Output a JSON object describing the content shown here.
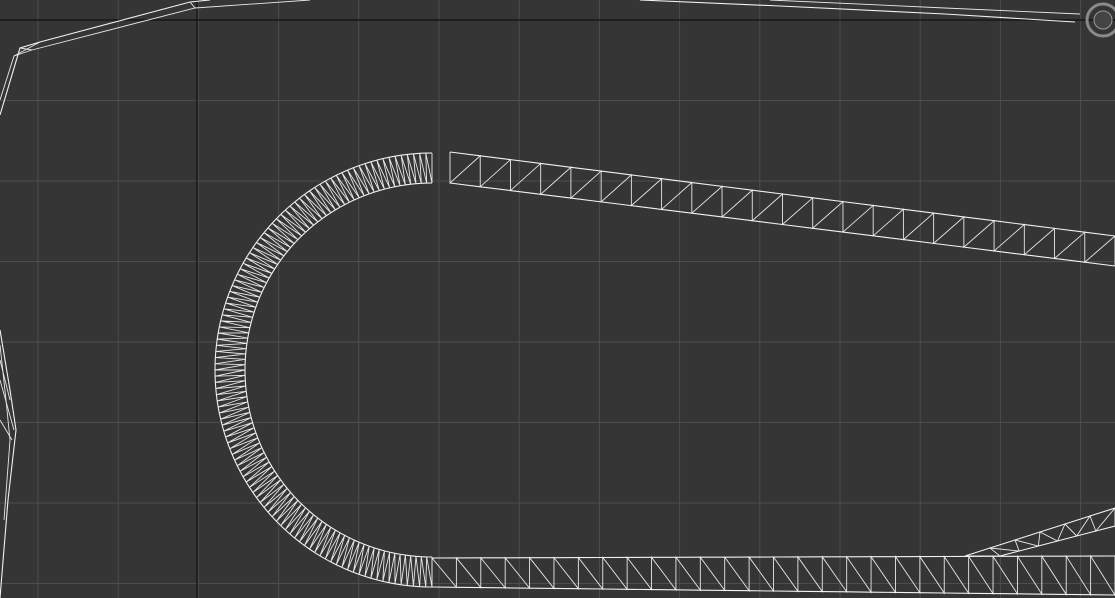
{
  "viewport": {
    "background_color": "#353535",
    "grid_color": "#4d4d4d",
    "world_axis_color": "#111111",
    "wireframe_color": "#e8e8e8"
  },
  "scene": {
    "objects": [
      {
        "name": "track-mesh",
        "kind": "wireframe-road-loop"
      },
      {
        "name": "left-edge-mesh",
        "kind": "wireframe-fragment"
      },
      {
        "name": "top-edge-mesh",
        "kind": "wireframe-fragment"
      }
    ]
  },
  "gizmo": {
    "icon": "viewcube-icon"
  }
}
